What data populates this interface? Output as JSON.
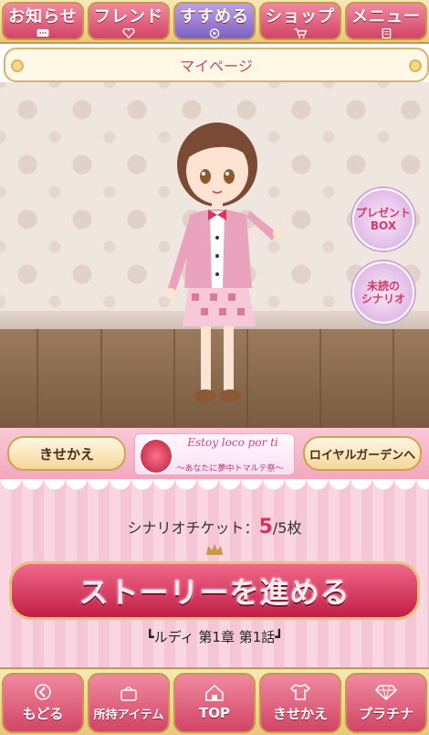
{
  "top_nav": [
    {
      "label": "お知らせ",
      "icon": "chat-icon"
    },
    {
      "label": "フレンド",
      "icon": "heart-icon"
    },
    {
      "label": "すすめる",
      "icon": "play-icon"
    },
    {
      "label": "ショップ",
      "icon": "cart-icon"
    },
    {
      "label": "メニュー",
      "icon": "document-icon"
    }
  ],
  "header": {
    "title": "マイページ"
  },
  "side_buttons": {
    "present_box": "プレゼント\nBOX",
    "unread_scenario": "未読の\nシナリオ"
  },
  "mid_buttons": {
    "dressup": "きせかえ",
    "royal_garden": "ロイヤルガーデンへ"
  },
  "banner": {
    "title": "Estoy loco por ti",
    "subtitle": "〜あなたに夢中トマルテ祭〜"
  },
  "ticket": {
    "label": "シナリオチケット：",
    "current": "5",
    "total": "/5枚"
  },
  "story_button": {
    "label": "ストーリーを進める"
  },
  "chapter": {
    "text": "┗ルディ 第1章 第1話┛"
  },
  "bottom_nav": [
    {
      "label": "もどる",
      "icon": "back-icon"
    },
    {
      "label": "所持アイテム",
      "icon": "bag-icon"
    },
    {
      "label": "TOP",
      "icon": "home-icon"
    },
    {
      "label": "きせかえ",
      "icon": "shirt-icon"
    },
    {
      "label": "プラチナ",
      "icon": "diamond-icon"
    }
  ],
  "colors": {
    "accent_pink": "#d24466",
    "gold": "#c99846",
    "stripe_pink": "#f9d6e1"
  }
}
